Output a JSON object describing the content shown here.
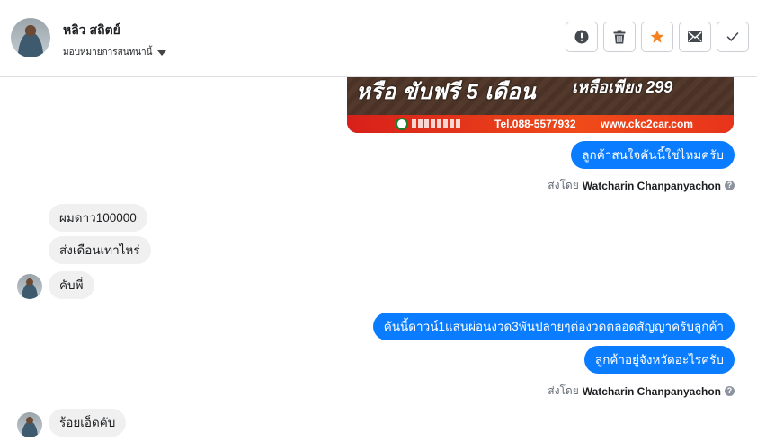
{
  "header": {
    "contact_name": "หลิว สถิตย์",
    "assign_label": "มอบหมายการสนทนานี้",
    "actions": [
      {
        "name": "spam-report",
        "icon": "exclamation-circle-icon",
        "color": "#444950"
      },
      {
        "name": "delete",
        "icon": "trash-icon",
        "color": "#444950"
      },
      {
        "name": "star",
        "icon": "star-icon",
        "color": "#f5821f"
      },
      {
        "name": "mark-unread",
        "icon": "envelope-icon",
        "color": "#444950"
      },
      {
        "name": "mark-done",
        "icon": "checkmark-icon",
        "color": "#444950"
      }
    ]
  },
  "banner": {
    "promo_left": "หรือ ขับฟรี 5 เดือน",
    "promo_right": "เหลือเพียง 299",
    "phone": "Tel.088-5577932",
    "website": "www.ckc2car.com"
  },
  "messages": [
    {
      "id": "m1",
      "direction": "outgoing",
      "text": "ลูกค้าสนใจคันนี้ใช่ไหมครับ"
    },
    {
      "id": "m2",
      "direction": "incoming",
      "text": "ผมดาว100000"
    },
    {
      "id": "m3",
      "direction": "incoming",
      "text": "ส่งเดือนเท่าไหร่"
    },
    {
      "id": "m4",
      "direction": "incoming",
      "text": "คับพี่"
    },
    {
      "id": "m5",
      "direction": "outgoing",
      "text": "คันนี้ดาวน์1แสนผ่อนงวด3พันปลายๆต่องวดตลอดสัญญาครับลูกค้า"
    },
    {
      "id": "m6",
      "direction": "outgoing",
      "text": "ลูกค้าอยู่จังหวัดอะไรครับ"
    },
    {
      "id": "m7",
      "direction": "incoming",
      "text": "ร้อยเอ็ดคับ"
    }
  ],
  "sent_by": {
    "prefix": "ส่งโดย",
    "agent": "Watcharin Chanpanyachon",
    "help_glyph": "?"
  },
  "colors": {
    "outgoing_bubble": "#0a7cff",
    "incoming_bubble": "#f0f0f0",
    "star_accent": "#f5821f"
  }
}
